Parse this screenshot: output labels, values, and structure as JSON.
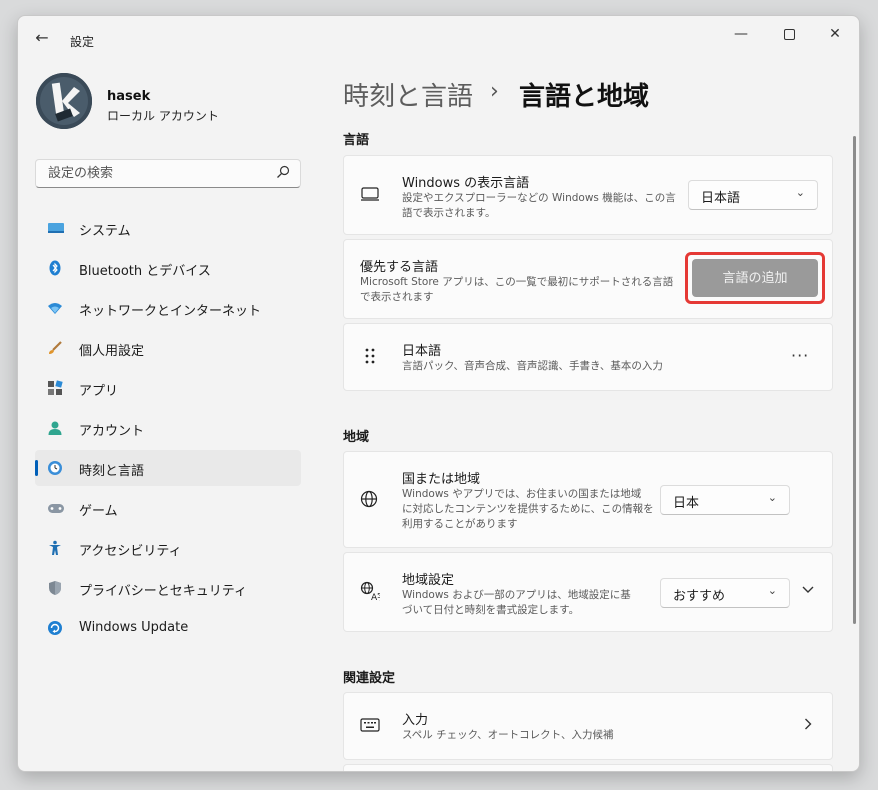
{
  "app": {
    "title": "設定",
    "back": "←",
    "minimize": "—",
    "close": "✕"
  },
  "user": {
    "name": "hasek",
    "account_type": "ローカル アカウント"
  },
  "search": {
    "placeholder": "設定の検索",
    "icon": "⌕"
  },
  "nav": [
    {
      "label": "システム",
      "icon": "system-icon"
    },
    {
      "label": "Bluetooth とデバイス",
      "icon": "bluetooth-icon"
    },
    {
      "label": "ネットワークとインターネット",
      "icon": "wifi-icon"
    },
    {
      "label": "個人用設定",
      "icon": "brush-icon"
    },
    {
      "label": "アプリ",
      "icon": "apps-icon"
    },
    {
      "label": "アカウント",
      "icon": "person-icon"
    },
    {
      "label": "時刻と言語",
      "icon": "clock-globe-icon",
      "active": true
    },
    {
      "label": "ゲーム",
      "icon": "gamepad-icon"
    },
    {
      "label": "アクセシビリティ",
      "icon": "accessibility-icon"
    },
    {
      "label": "プライバシーとセキュリティ",
      "icon": "shield-icon"
    },
    {
      "label": "Windows Update",
      "icon": "update-icon"
    }
  ],
  "breadcrumb": {
    "parent": "時刻と言語",
    "separator": "›",
    "current": "言語と地域"
  },
  "sections": {
    "language": "言語",
    "region": "地域",
    "related": "関連設定"
  },
  "display_language": {
    "title": "Windows の表示言語",
    "desc1": "設定やエクスプローラーなどの Windows 機能は、この言",
    "desc2": "語で表示されます。",
    "value": "日本語"
  },
  "preferred_language": {
    "title": "優先する言語",
    "desc1": "Microsoft Store アプリは、この一覧で最初にサポートされる言語",
    "desc2": "で表示されます",
    "button": "言語の追加"
  },
  "japanese_lang": {
    "title": "日本語",
    "desc": "言語パック、音声合成、音声認識、手書き、基本の入力",
    "more": "···"
  },
  "country": {
    "title": "国または地域",
    "desc1": "Windows やアプリでは、お住まいの国または地域",
    "desc2": "に対応したコンテンツを提供するために、この情報を",
    "desc3": "利用することがあります",
    "value": "日本"
  },
  "regional_format": {
    "title": "地域設定",
    "desc1": "Windows および一部のアプリは、地域設定に基",
    "desc2": "づいて日付と時刻を書式設定します。",
    "value": "おすすめ"
  },
  "typing": {
    "title": "入力",
    "desc": "スペル チェック、オートコレクト、入力候補"
  },
  "colors": {
    "accent": "#005fb8",
    "highlight": "#e53935"
  }
}
